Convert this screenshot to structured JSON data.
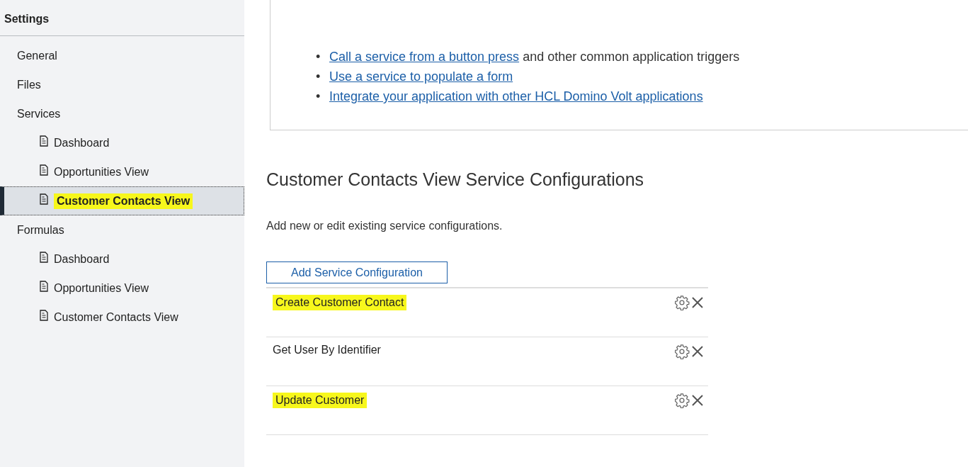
{
  "sidebar": {
    "title": "Settings",
    "items": [
      {
        "label": "General",
        "selected": false,
        "highlighted": false
      },
      {
        "label": "Files",
        "selected": false,
        "highlighted": false
      },
      {
        "label": "Services",
        "selected": false,
        "highlighted": false,
        "children": [
          {
            "label": "Dashboard",
            "selected": false,
            "highlighted": false
          },
          {
            "label": "Opportunities View",
            "selected": false,
            "highlighted": false
          },
          {
            "label": "Customer Contacts View",
            "selected": true,
            "highlighted": true
          }
        ]
      },
      {
        "label": "Formulas",
        "selected": false,
        "highlighted": false,
        "children": [
          {
            "label": "Dashboard",
            "selected": false,
            "highlighted": false
          },
          {
            "label": "Opportunities View",
            "selected": false,
            "highlighted": false
          },
          {
            "label": "Customer Contacts View",
            "selected": false,
            "highlighted": false
          }
        ]
      }
    ]
  },
  "info_card": {
    "bullets": [
      {
        "marker": "•",
        "link": "Call a service from a button press",
        "text": "and other common application triggers"
      },
      {
        "marker": "•",
        "link": "Use a service to populate a form"
      },
      {
        "marker": "•",
        "link": "Integrate your application with other HCL Domino Volt applications"
      }
    ]
  },
  "heading": "Customer Contacts View Service Configurations",
  "description": "Add new or edit existing service configurations.",
  "add_button": "Add Service Configuration",
  "configurations": [
    {
      "name": "Create Customer Contact",
      "highlighted": true
    },
    {
      "name": "Get User By Identifier",
      "highlighted": false
    },
    {
      "name": "Update Customer",
      "highlighted": true
    }
  ]
}
